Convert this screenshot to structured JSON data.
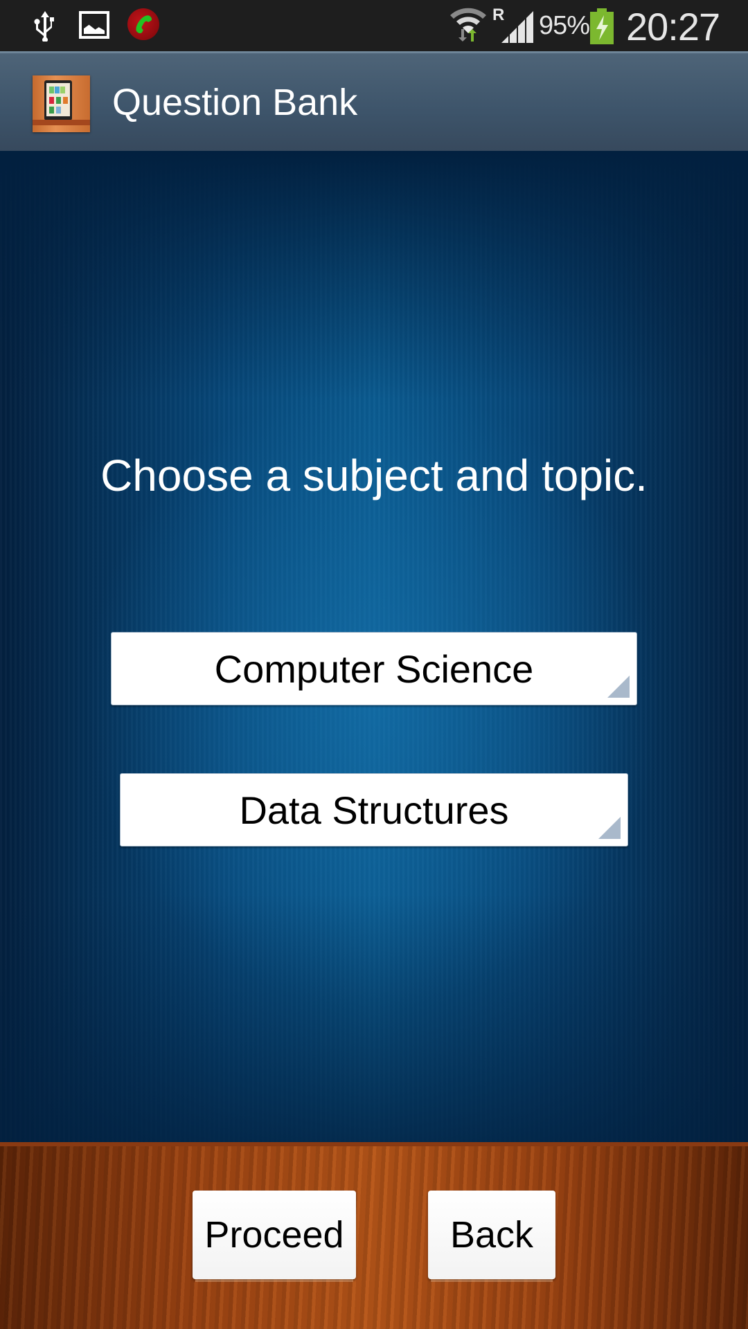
{
  "status_bar": {
    "left_icons": [
      "usb-icon",
      "gallery-icon",
      "call-recorder-icon"
    ],
    "right_icons": [
      "wifi-icon",
      "roaming-indicator",
      "signal-icon",
      "battery-charging-icon"
    ],
    "roaming_label": "R",
    "battery_percent": "95%",
    "time": "20:27",
    "colors": {
      "battery": "#7cb82f",
      "call_icon": "#c0141a",
      "call_handset": "#22c322"
    }
  },
  "action_bar": {
    "app_icon": "bookshelf-tablet-icon",
    "title": "Question Bank"
  },
  "main": {
    "prompt": "Choose a subject and topic.",
    "subject_spinner": {
      "selected": "Computer Science"
    },
    "topic_spinner": {
      "selected": "Data Structures"
    }
  },
  "footer": {
    "proceed_label": "Proceed",
    "back_label": "Back"
  }
}
